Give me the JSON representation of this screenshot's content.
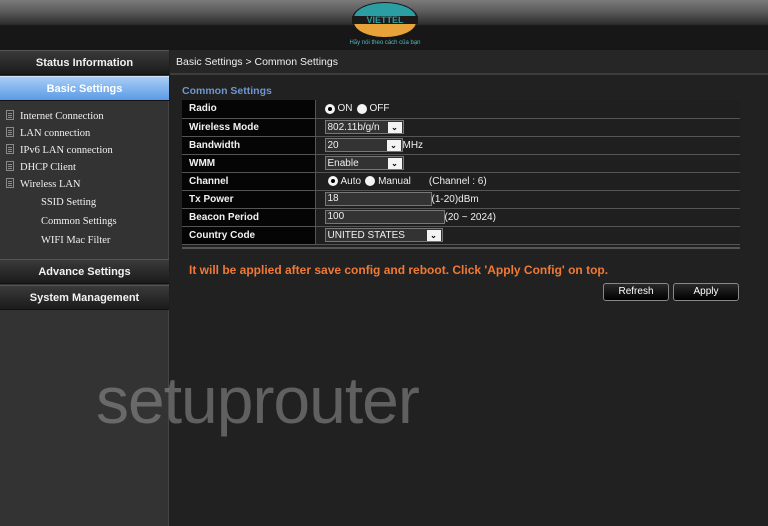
{
  "header": {
    "logo_text": "VIETTEL",
    "tagline": "Hãy nói theo cách của bạn"
  },
  "sidebar": {
    "sections": [
      {
        "label": "Status Information",
        "active": false
      },
      {
        "label": "Basic Settings",
        "active": true
      },
      {
        "label": "Advance Settings",
        "active": false
      },
      {
        "label": "System Management",
        "active": false
      }
    ],
    "items": [
      {
        "label": "Internet Connection",
        "icon": "document-icon"
      },
      {
        "label": "LAN connection",
        "icon": "document-icon"
      },
      {
        "label": "IPv6 LAN connection",
        "icon": "document-icon"
      },
      {
        "label": "DHCP Client",
        "icon": "document-icon"
      },
      {
        "label": "Wireless LAN",
        "icon": "document-icon"
      }
    ],
    "subitems": [
      {
        "label": "SSID Setting"
      },
      {
        "label": "Common Settings"
      },
      {
        "label": "WIFI Mac Filter"
      }
    ]
  },
  "main": {
    "breadcrumb": "Basic Settings > Common Settings",
    "section_title": "Common Settings",
    "rows": {
      "radio": {
        "label": "Radio",
        "options": [
          "ON",
          "OFF"
        ],
        "selected": "ON"
      },
      "wireless_mode": {
        "label": "Wireless Mode",
        "value": "802.11b/g/n"
      },
      "bandwidth": {
        "label": "Bandwidth",
        "value": "20",
        "unit": "MHz"
      },
      "wmm": {
        "label": "WMM",
        "value": "Enable"
      },
      "channel": {
        "label": "Channel",
        "options": [
          "Auto",
          "Manual"
        ],
        "selected": "Auto",
        "info": "(Channel : 6)"
      },
      "tx_power": {
        "label": "Tx Power",
        "value": "18",
        "unit": "(1-20)dBm"
      },
      "beacon_period": {
        "label": "Beacon Period",
        "value": "100",
        "unit": "(20 ~ 2024)"
      },
      "country_code": {
        "label": "Country Code",
        "value": "UNITED STATES"
      }
    },
    "notice": "It will be applied after save config and reboot. Click 'Apply Config' on top.",
    "buttons": {
      "refresh": "Refresh",
      "apply": "Apply"
    },
    "notice_color": "#f07a35",
    "accent_color": "#5a9be6"
  },
  "watermark": "setuprouter"
}
